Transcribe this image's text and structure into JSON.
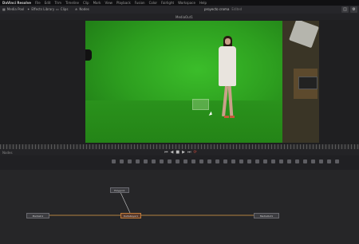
{
  "menubar": {
    "app": "DaVinci Resolve",
    "items": [
      "File",
      "Edit",
      "Trim",
      "Timeline",
      "Clip",
      "Mark",
      "View",
      "Playback",
      "Fusion",
      "Color",
      "Fairlight",
      "Workspace",
      "Help"
    ]
  },
  "toolbar": {
    "left_a": "Media Pool",
    "left_b": "Effects Library",
    "left_c": "Clips",
    "left_d": "Nodes",
    "project_name": "proyecto croma",
    "project_state": "Edited"
  },
  "viewer": {
    "title": "MediaOut1"
  },
  "transport": {
    "left_label": "Nodes"
  },
  "nodes": {
    "a": "MediaIn1",
    "b": "DeltaKeyer1",
    "c": "MediaOut1",
    "d": "Polygon1"
  },
  "colors": {
    "green_screen": "#2b9a1e",
    "accent": "#c07a3a"
  }
}
